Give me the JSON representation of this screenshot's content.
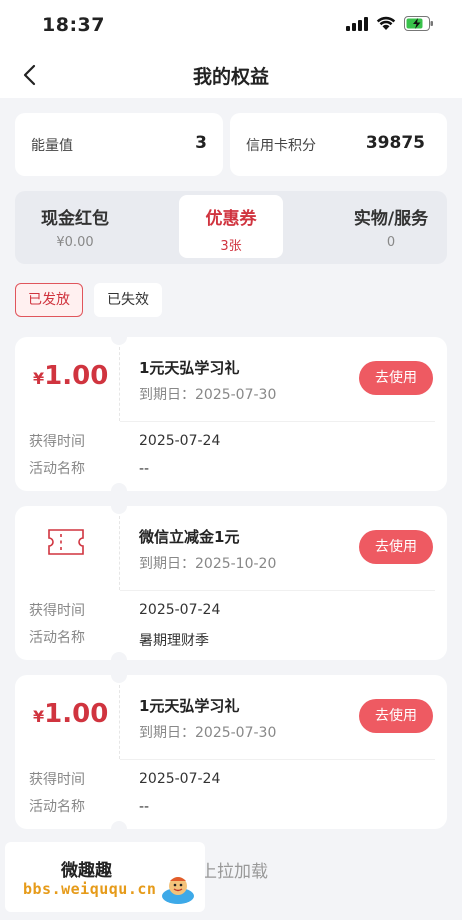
{
  "status_bar": {
    "time": "18:37",
    "icons": [
      "signal-icon",
      "wifi-icon",
      "battery-charging-icon"
    ],
    "battery_color": "#39c24b"
  },
  "nav": {
    "title": "我的权益",
    "back_icon": "chevron-left-icon"
  },
  "metrics": [
    {
      "label": "能量值",
      "value": "3"
    },
    {
      "label": "信用卡积分",
      "value": "39875"
    }
  ],
  "tabs": [
    {
      "title": "现金红包",
      "sub": "¥0.00",
      "active": false
    },
    {
      "title": "优惠券",
      "sub": "3张",
      "active": true
    },
    {
      "title": "实物/服务",
      "sub": "0",
      "active": false
    }
  ],
  "filters": [
    {
      "label": "已发放",
      "active": true
    },
    {
      "label": "已失效",
      "active": false
    }
  ],
  "coupons": [
    {
      "yen": "¥",
      "amount": "1.00",
      "title": "1元天弘学习礼",
      "expiry": "到期日：2025-07-30",
      "button": "去使用",
      "acquired_label": "获得时间",
      "acquired_value": "2025-07-24",
      "activity_label": "活动名称",
      "activity_value": "--"
    },
    {
      "icon": "ticket-icon",
      "title": "微信立减金1元",
      "expiry": "到期日：2025-10-20",
      "button": "去使用",
      "acquired_label": "获得时间",
      "acquired_value": "2025-07-24",
      "activity_label": "活动名称",
      "activity_value": "暑期理财季"
    },
    {
      "yen": "¥",
      "amount": "1.00",
      "title": "1元天弘学习礼",
      "expiry": "到期日：2025-07-30",
      "button": "去使用",
      "acquired_label": "获得时间",
      "acquired_value": "2025-07-24",
      "activity_label": "活动名称",
      "activity_value": "--"
    }
  ],
  "load_more": {
    "icon": "arrow-up-icon",
    "text": "上拉加载"
  },
  "watermark": {
    "title": "微趣趣",
    "url": "bbs.weiququ.cn"
  },
  "colors": {
    "accent": "#d0343f",
    "button": "#ee5a62",
    "background": "#f3f4f7"
  }
}
